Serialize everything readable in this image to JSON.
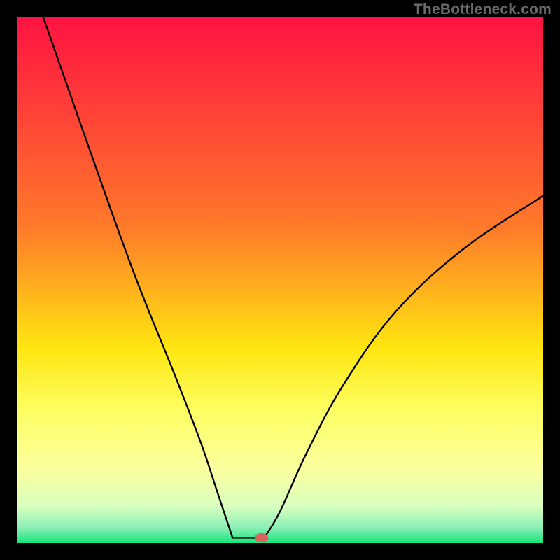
{
  "watermark": "TheBottleneck.com",
  "chart_data": {
    "type": "line",
    "title": "",
    "xlabel": "",
    "ylabel": "",
    "xlim": [
      0,
      100
    ],
    "ylim": [
      0,
      100
    ],
    "gradient_stops": [
      {
        "offset": 0,
        "color": "#ff1242"
      },
      {
        "offset": 40,
        "color": "#ff7a2a"
      },
      {
        "offset": 63,
        "color": "#ffe610"
      },
      {
        "offset": 75,
        "color": "#fdff63"
      },
      {
        "offset": 86,
        "color": "#fbff9e"
      },
      {
        "offset": 93,
        "color": "#d8ffbe"
      },
      {
        "offset": 97,
        "color": "#8cf0b7"
      },
      {
        "offset": 100,
        "color": "#18e47a"
      }
    ],
    "curve": {
      "left_branch": [
        {
          "x": 5,
          "y": 100
        },
        {
          "x": 12,
          "y": 80
        },
        {
          "x": 22,
          "y": 52
        },
        {
          "x": 30,
          "y": 32
        },
        {
          "x": 35,
          "y": 19
        },
        {
          "x": 38,
          "y": 10
        },
        {
          "x": 40,
          "y": 4
        },
        {
          "x": 41,
          "y": 1
        }
      ],
      "floor": [
        {
          "x": 41,
          "y": 1
        },
        {
          "x": 47,
          "y": 1
        }
      ],
      "right_branch": [
        {
          "x": 47,
          "y": 1
        },
        {
          "x": 50,
          "y": 6
        },
        {
          "x": 55,
          "y": 17
        },
        {
          "x": 62,
          "y": 30
        },
        {
          "x": 72,
          "y": 44
        },
        {
          "x": 85,
          "y": 56
        },
        {
          "x": 100,
          "y": 66
        }
      ]
    },
    "marker": {
      "x": 46.5,
      "y": 1,
      "color": "#d8665d"
    }
  }
}
